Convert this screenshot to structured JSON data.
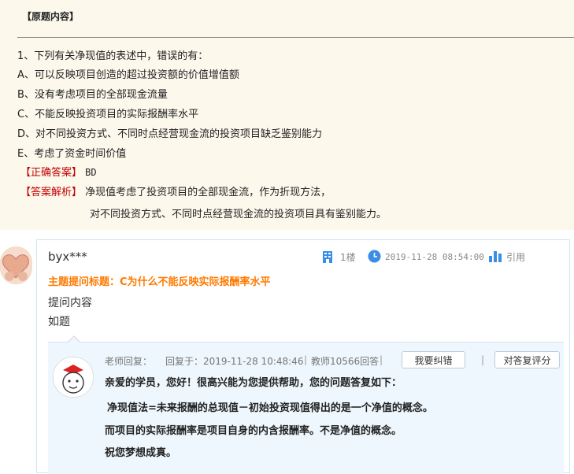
{
  "original": {
    "title": "【原题内容】",
    "question": "1、下列有关净现值的表述中，错误的有：",
    "options": [
      "A、可以反映项目创造的超过投资额的价值增值额",
      "B、没有考虑项目的全部现金流量",
      "C、不能反映投资项目的实际报酬率水平",
      "D、对不同投资方式、不同时点经营现金流的投资项目缺乏鉴别能力",
      "E、考虑了资金时间价值"
    ],
    "answer_label": "【正确答案】",
    "answer": "BD",
    "analysis_label": "【答案解析】",
    "analysis_line1": "净现值考虑了投资项目的全部现金流，作为折现方法，",
    "analysis_line2": "对不同投资方式、不同时点经营现金流的投资项目具有鉴别能力。"
  },
  "post": {
    "username": "byx***",
    "floor": "1楼",
    "datetime": "2019-11-28 08:54:00",
    "quote": "引用",
    "topic_label": "主题提问标题：",
    "topic": "C为什么不能反映实际报酬率水平",
    "content_label": "提问内容",
    "content": "如题"
  },
  "reply": {
    "label": "老师回复：",
    "reply_time": "回复于：2019-11-28 10:48:46",
    "teacher": "教师10566回答",
    "correct_button": "我要纠错",
    "rate_button": "对答复评分",
    "lines": [
      "亲爱的学员，您好！很高兴能为您提供帮助，您的问题答复如下：",
      "净现值法=未来报酬的总现值－初始投资现值得出的是一个净值的概念。",
      "而项目的实际报酬率是项目自身的内含报酬率。不是净值的概念。",
      "祝您梦想成真。"
    ]
  },
  "colors": {
    "accent_orange": "#ff7a00",
    "answer_red": "#c00000",
    "icon_blue": "#3a8ee6"
  },
  "icons": [
    "building-icon",
    "clock-icon",
    "bar-chart-icon"
  ]
}
